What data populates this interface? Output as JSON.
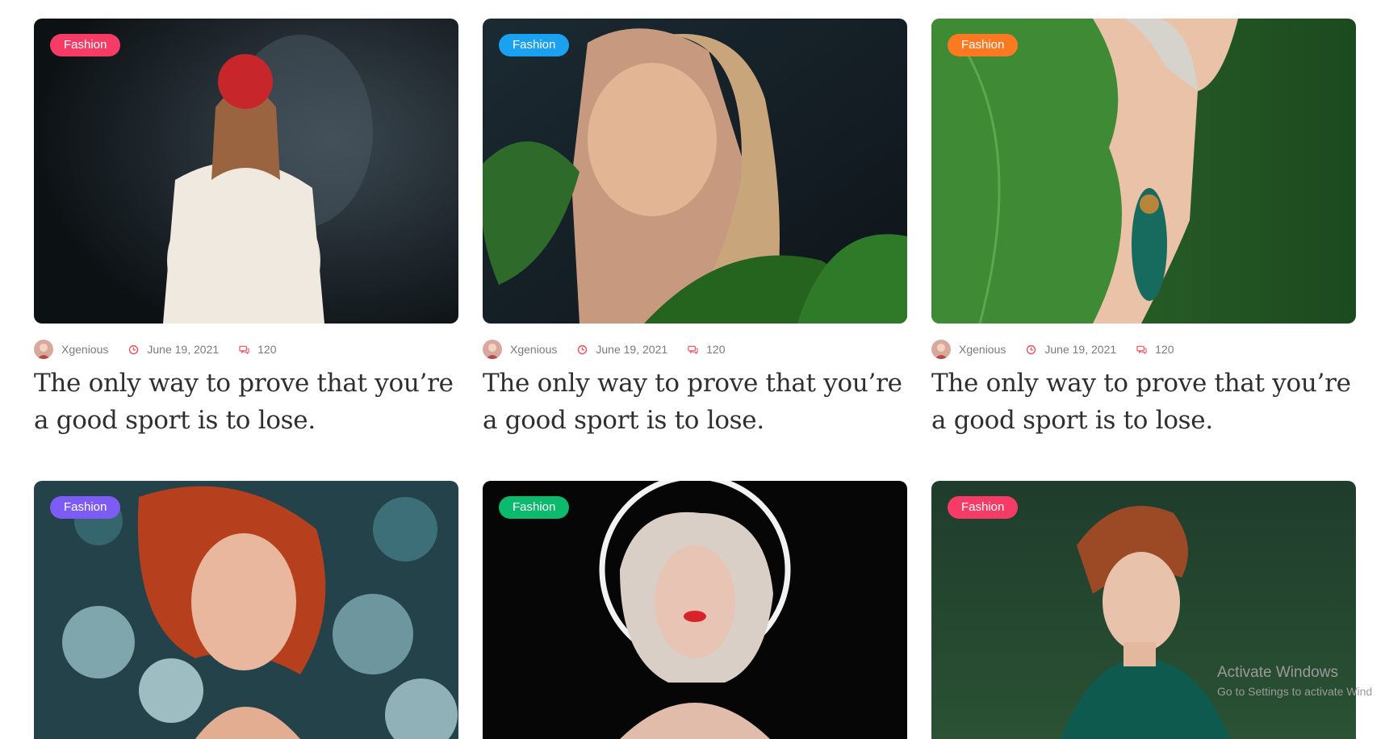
{
  "cards": [
    {
      "category": "Fashion",
      "category_color": "#f53b66",
      "author": "Xgenious",
      "date": "June 19, 2021",
      "comments": "120",
      "title": "The only way to prove that you’re a good sport is to lose."
    },
    {
      "category": "Fashion",
      "category_color": "#1aa1f0",
      "author": "Xgenious",
      "date": "June 19, 2021",
      "comments": "120",
      "title": "The only way to prove that you’re a good sport is to lose."
    },
    {
      "category": "Fashion",
      "category_color": "#fb7a21",
      "author": "Xgenious",
      "date": "June 19, 2021",
      "comments": "120",
      "title": "The only way to prove that you’re a good sport is to lose."
    },
    {
      "category": "Fashion",
      "category_color": "#7c5cf5"
    },
    {
      "category": "Fashion",
      "category_color": "#0cba6e"
    },
    {
      "category": "Fashion",
      "category_color": "#f53b66"
    }
  ],
  "meta_icon_color": "#f0505a",
  "watermark": {
    "line1": "Activate Windows",
    "line2": "Go to Settings to activate Wind"
  }
}
